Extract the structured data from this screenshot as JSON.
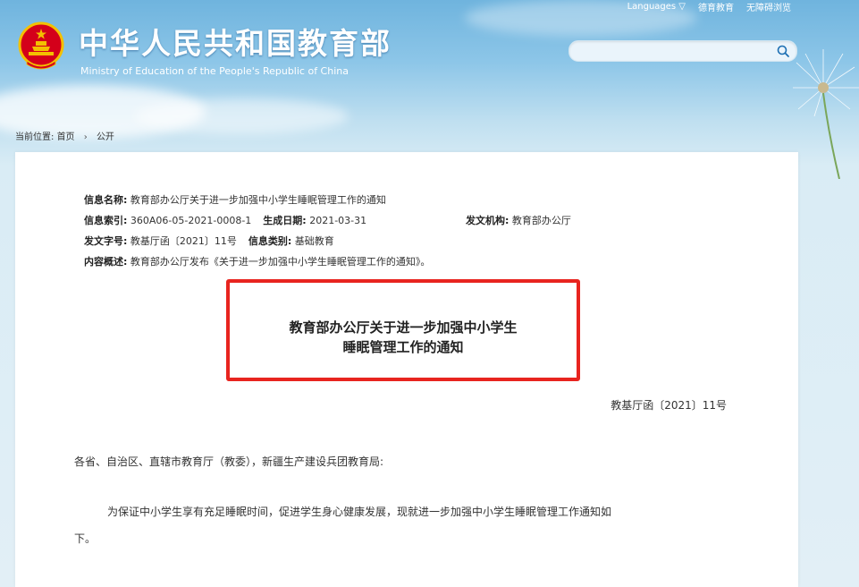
{
  "topbar": {
    "languages": "Languages ▽",
    "accessibility_1": "德育教育",
    "accessibility_2": "无障碍浏览"
  },
  "site": {
    "title": "中华人民共和国教育部",
    "subtitle": "Ministry of Education of the People's Republic of China"
  },
  "search": {
    "placeholder": ""
  },
  "breadcrumb": {
    "prefix": "当前位置:",
    "home": "首页",
    "separator": "›",
    "current": "公开"
  },
  "meta": {
    "name_label": "信息名称:",
    "name_value": "教育部办公厅关于进一步加强中小学生睡眠管理工作的通知",
    "index_label": "信息索引:",
    "index_value": "360A06-05-2021-0008-1",
    "date_label": "生成日期:",
    "date_value": "2021-03-31",
    "org_label": "发文机构:",
    "org_value": "教育部办公厅",
    "docno_label": "发文字号:",
    "docno_value": "教基厅函〔2021〕11号",
    "category_label": "信息类别:",
    "category_value": "基础教育",
    "summary_label": "内容概述:",
    "summary_value": "教育部办公厅发布《关于进一步加强中小学生睡眠管理工作的通知》。"
  },
  "document": {
    "title_line1": "教育部办公厅关于进一步加强中小学生",
    "title_line2": "睡眠管理工作的通知",
    "doc_number": "教基厅函〔2021〕11号",
    "addressee": "各省、自治区、直辖市教育厅（教委），新疆生产建设兵团教育局:",
    "body_line1": "为保证中小学生享有充足睡眠时间，促进学生身心健康发展，现就进一步加强中小学生睡眠管理工作通知如",
    "body_line2": "下。"
  },
  "colors": {
    "highlight_border": "#e8241f",
    "header_sky": "#6fb4de"
  }
}
